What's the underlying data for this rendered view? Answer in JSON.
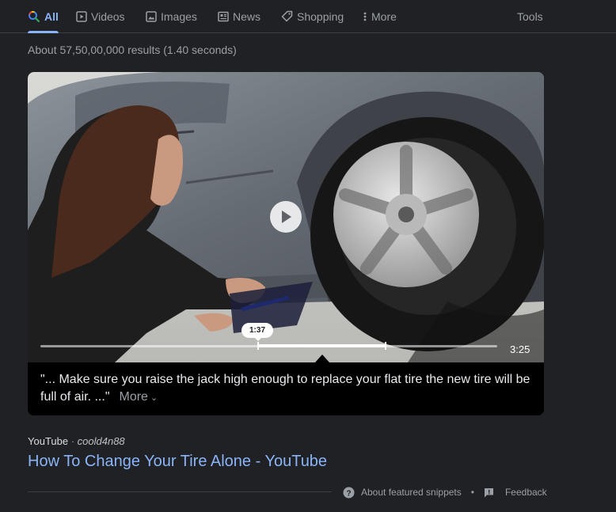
{
  "tabs": [
    {
      "label": "All",
      "icon": "search-icon",
      "active": true
    },
    {
      "label": "Videos",
      "icon": "video-icon"
    },
    {
      "label": "Images",
      "icon": "image-icon"
    },
    {
      "label": "News",
      "icon": "news-icon"
    },
    {
      "label": "Shopping",
      "icon": "tag-icon"
    },
    {
      "label": "More",
      "icon": "more-vert-icon"
    }
  ],
  "tools_label": "Tools",
  "stats": "About 57,50,00,000 results (1.40 seconds)",
  "video": {
    "timestamp": "1:37",
    "duration": "3:25",
    "caption": "\"... Make sure you raise the jack high enough to replace your flat tire the new tire will be full of air. ...\"",
    "more_label": "More"
  },
  "result": {
    "source": "YouTube",
    "separator": " · ",
    "author": "coold4n88",
    "title": "How To Change Your Tire Alone - YouTube"
  },
  "footer": {
    "about_label": "About featured snippets",
    "separator": "•",
    "feedback_label": "Feedback"
  },
  "colors": {
    "background": "#202124",
    "link": "#8ab4f8",
    "text": "#bdc1c6",
    "muted": "#9aa0a6"
  }
}
